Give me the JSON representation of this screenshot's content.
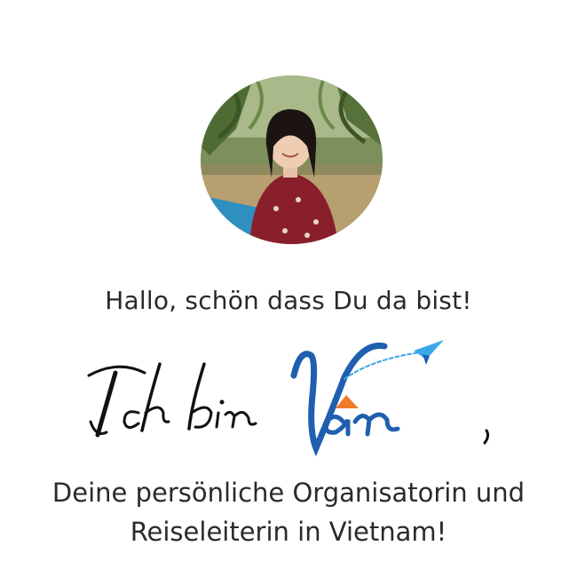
{
  "profile": {
    "avatar_alt": "Portrait of Van in a boat under palm trees"
  },
  "intro": {
    "greeting": "Hallo, schön dass Du da bist!"
  },
  "signature": {
    "text": "Ich bin Van ,"
  },
  "tagline": {
    "line1": "Deine persönliche Organisatorin und",
    "line2": "Reiseleiterin in Vietnam!"
  },
  "colors": {
    "script_black": "#111111",
    "brand_blue": "#1f5fb0",
    "plane_blue": "#3aa9e8",
    "hat_orange": "#ef7b2a",
    "text": "#2a2a2a"
  }
}
